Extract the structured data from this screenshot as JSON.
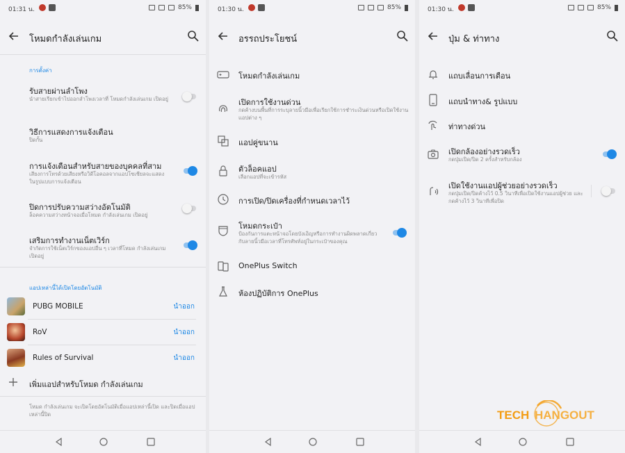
{
  "screen1": {
    "status": {
      "time": "01:31 น.",
      "battery": "85%"
    },
    "title": "โหมดกำลังเล่นเกม",
    "section_settings": "การตั้งค่า",
    "items": [
      {
        "title": "รับสายผ่านลำโพง",
        "subtitle": "นำสายเรียกเข้าไปออกลำโพงเวลาที่ โหมดกำลังเล่นเกม เปิดอยู่"
      },
      {
        "title": "วิธีการแสดงการแจ้งเตือน",
        "subtitle": "ปิดกั้น"
      },
      {
        "title": "การแจ้งเตือนสำหรับสายของบุคคลที่สาม",
        "subtitle": "เสียงการโทรด้วยเสียงหรือวิดีโอคอลจากแอปโซเชียลจะแสดงในรูปแบบการแจ้งเตือน"
      },
      {
        "title": "ปิดการปรับความสว่างอัตโนมัติ",
        "subtitle": "ล็อคความสว่างหน้าจอเมื่อโหมด กำลังเล่นเกม เปิดอยู่"
      },
      {
        "title": "เสริมการทำงานเน็ตเวิร์ก",
        "subtitle": "จำกัดการใช้เน็ตเวิร์กของแอปอื่น ๆ เวลาที่โหมด กำลังเล่นเกม เปิดอยู่"
      }
    ],
    "section_apps": "แอปเหล่านี้ได้เปิดโดยอัตโนมัติ",
    "games": [
      {
        "name": "PUBG MOBILE",
        "action": "นำออก"
      },
      {
        "name": "RoV",
        "action": "นำออก"
      },
      {
        "name": "Rules of Survival",
        "action": "นำออก"
      }
    ],
    "add_label": "เพิ่มแอปสำหรับโหมด กำลังเล่นเกม",
    "footer": "โหมด กำลังเล่นเกม จะเปิดโดยอัตโนมัติเมื่อแอปเหล่านี้เปิด และปิดเมื่อแอปเหล่านี้ปิด"
  },
  "screen2": {
    "status": {
      "time": "01:30 น.",
      "battery": "85%"
    },
    "title": "อรรถประโยชน์",
    "items": [
      {
        "title": "โหมดกำลังเล่นเกม",
        "subtitle": "",
        "icon": "gamepad-icon"
      },
      {
        "title": "เปิดการใช้งานด่วน",
        "subtitle": "กดค้างบนพื้นที่การระบุลายนิ้วมือเพื่อเรียกใช้การชำระเงินด่วนหรือเปิดใช้งานแอปต่าง ๆ",
        "icon": "fingerprint-icon"
      },
      {
        "title": "แอปคู่ขนาน",
        "subtitle": "",
        "icon": "parallel-apps-icon"
      },
      {
        "title": "ตัวล็อคแอป",
        "subtitle": "เลือกแอปที่จะเข้ารหัส",
        "icon": "lock-icon"
      },
      {
        "title": "การเปิด/ปิดเครื่องที่กำหนดเวลาไว้",
        "subtitle": "",
        "icon": "clock-icon"
      },
      {
        "title": "โหมดกระเป๋า",
        "subtitle": "ป้องกันการแตะหน้าจอโดยบังเอิญหรือการทำงานผิดพลาดเกี่ยวกับลายนิ้วมือเวลาที่โทรศัพท์อยู่ในกระเป๋าของคุณ",
        "icon": "pocket-icon"
      },
      {
        "title": "OnePlus Switch",
        "subtitle": "",
        "icon": "phone-switch-icon"
      },
      {
        "title": "ห้องปฏิบัติการ OnePlus",
        "subtitle": "",
        "icon": "lab-flask-icon"
      }
    ]
  },
  "screen3": {
    "status": {
      "time": "01:30 น.",
      "battery": "85%"
    },
    "title": "ปุ่ม & ท่าทาง",
    "items": [
      {
        "title": "แถบเลื่อนการเตือน",
        "subtitle": "",
        "icon": "alert-slider-icon"
      },
      {
        "title": "แถบนำทาง& รูปแบบ",
        "subtitle": "",
        "icon": "navbar-icon"
      },
      {
        "title": "ท่าทางด่วน",
        "subtitle": "",
        "icon": "gesture-icon"
      },
      {
        "title": "เปิดกล้องอย่างรวดเร็ว",
        "subtitle": "กดปุ่มเปิด/ปิด 2 ครั้งสำหรับกล้อง",
        "icon": "camera-icon"
      },
      {
        "title": "เปิดใช้งานแอปผู้ช่วยอย่างรวดเร็ว",
        "subtitle": "กดปุ่มเปิด/ปิดค้างไว้ 0.5 วินาทีเพื่อเปิดใช้งานแอปผู้ช่วย และกดค้างไว้ 3 วินาทีเพื่อปิด",
        "icon": "assistant-icon"
      }
    ]
  },
  "toggles": {
    "s1_speaker": false,
    "s1_third_party": true,
    "s1_brightness": false,
    "s1_network": true,
    "s2_pocket": true,
    "s3_camera": true,
    "s3_assistant": false
  },
  "logo": {
    "text_a": "TECH",
    "text_b": "HANGOUT"
  },
  "colors": {
    "accent": "#1e88e5",
    "background": "#f2f2f5",
    "logo_orange": "#f39c12"
  }
}
